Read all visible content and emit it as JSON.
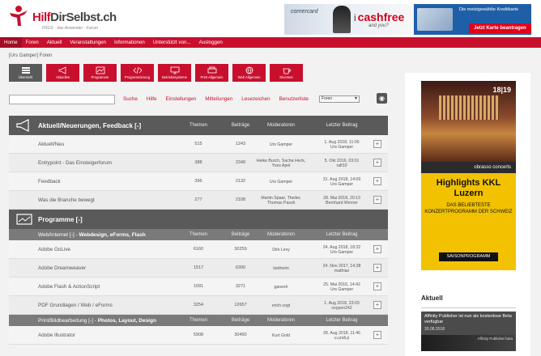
{
  "header": {
    "logo_text_red": "Hilf",
    "logo_text_dark": "DirSelbst.ch",
    "logo_sub": "FROS · das Anwender · Forum",
    "banner_left_brand": "cornercard",
    "banner_cash_i": "i",
    "banner_cash": "cashfree",
    "banner_cash_tag": "and you?",
    "banner_right_text": "Die meistgewählte Kreditkarte",
    "banner_right_button": "Jetzt Karte beantragen"
  },
  "topnav": [
    "Home",
    "Foren",
    "Aktuell",
    "Veranstaltungen",
    "Informationen",
    "Unterstützt von...",
    "Ausloggen"
  ],
  "breadcrumb": "[Urs Gamper]  Foren",
  "iconbar": [
    "Übersicht",
    "Aktuelles",
    "Programme",
    "Programmierung",
    "Betriebssysteme",
    "Print Allgemein",
    "Web Allgemein",
    "Diverses"
  ],
  "search": {
    "placeholder": "",
    "links": [
      "Suche",
      "Hilfe",
      "Einstellungen",
      "Mitteilungen",
      "Lesezeichen",
      "Benutzerliste"
    ],
    "forum_select": "Foren"
  },
  "columns": {
    "threads": "Themen",
    "posts": "Beiträge",
    "moderators": "Moderatoren",
    "last": "Letzter Beitrag"
  },
  "categories": [
    {
      "title": "Aktuell/Neuerungen, Feedback [-]",
      "rows": [
        {
          "name": "Aktuell/Neu",
          "threads": "515",
          "posts": "1243",
          "mod": "Urs Gamper",
          "last_date": "1. Aug 2018, 11:06",
          "last_user": "Urs Gamper"
        },
        {
          "name": "Entrypoint - Das Einsteigerforum",
          "threads": "388",
          "posts": "2349",
          "mod": "Heike Burch, Sacha Heck, Yves Apel",
          "last_date": "5. Okt 2016, 03:01",
          "last_user": "ralf10"
        },
        {
          "name": "Feedback",
          "threads": "396",
          "posts": "2132",
          "mod": "Urs Gamper",
          "last_date": "31. Aug 2018, 14:09",
          "last_user": "Urs Gamper"
        },
        {
          "name": "Was die Branche bewegt",
          "threads": "277",
          "posts": "2108",
          "mod": "Martin Spaar, Theiler, Thomas Paszti",
          "last_date": "28. Mai 2018, 20:13",
          "last_user": "Bernhard Werner"
        }
      ]
    },
    {
      "title": "Programme [-]",
      "subcategories": [
        {
          "title_plain": "Web/Internet [-] - ",
          "title_bold": "Webdesign, eForms, Flash",
          "rows": [
            {
              "name": "Adobe GoLive",
              "threads": "6160",
              "posts": "30259",
              "mod": "Dirk Levy",
              "last_date": "24. Aug 2018, 18:32",
              "last_user": "Urs Gamper"
            },
            {
              "name": "Adobe Dreamweaver",
              "threads": "1517",
              "posts": "6300",
              "mod": "Isetheim",
              "last_date": "24. Nov 2017, 14:38",
              "last_user": "mathias"
            },
            {
              "name": "Adobe Flash & ActionScript",
              "threads": "1091",
              "posts": "3271",
              "mod": "ganesh",
              "last_date": "25. Mai 2016, 14:42",
              "last_user": "Urs Gamper"
            },
            {
              "name": "PDF Grundlagen / Web / eForms",
              "threads": "3254",
              "posts": "12657",
              "mod": "erich.vogt",
              "last_date": "1. Aug 2018, 23:03",
              "last_user": "ovypen242"
            }
          ]
        },
        {
          "title_plain": "Print/Bildbearbeitung [-] - ",
          "title_bold": "Photos, Layout, Design",
          "rows": [
            {
              "name": "Adobe Illustrator",
              "threads": "5908",
              "posts": "30490",
              "mod": "Kurt Gold",
              "last_date": "28. Aug 2018, 11:46",
              "last_user": "u.undi.p"
            }
          ]
        }
      ]
    }
  ],
  "sidebar": {
    "ad_number": "18|19",
    "ad_brand": "obrasso concerts",
    "ad_headline": "Highlights KKL Luzern",
    "ad_sub": "DAS BELIEBTESTE KONZERTPROGRAMM DER SCHWEIZ",
    "ad_button": "SAISONPROGRAMM",
    "aktuell_title": "Aktuell",
    "news_title": "Affinity Publisher ist nun als kostenlose Beta verfügbar",
    "news_date": "30.08.2018",
    "news_img_caption": "Affinity Publisher beta"
  },
  "colors": {
    "brand_red": "#c8102e",
    "dark_gray": "#5a5a5a",
    "ad_yellow": "#f2c200"
  }
}
